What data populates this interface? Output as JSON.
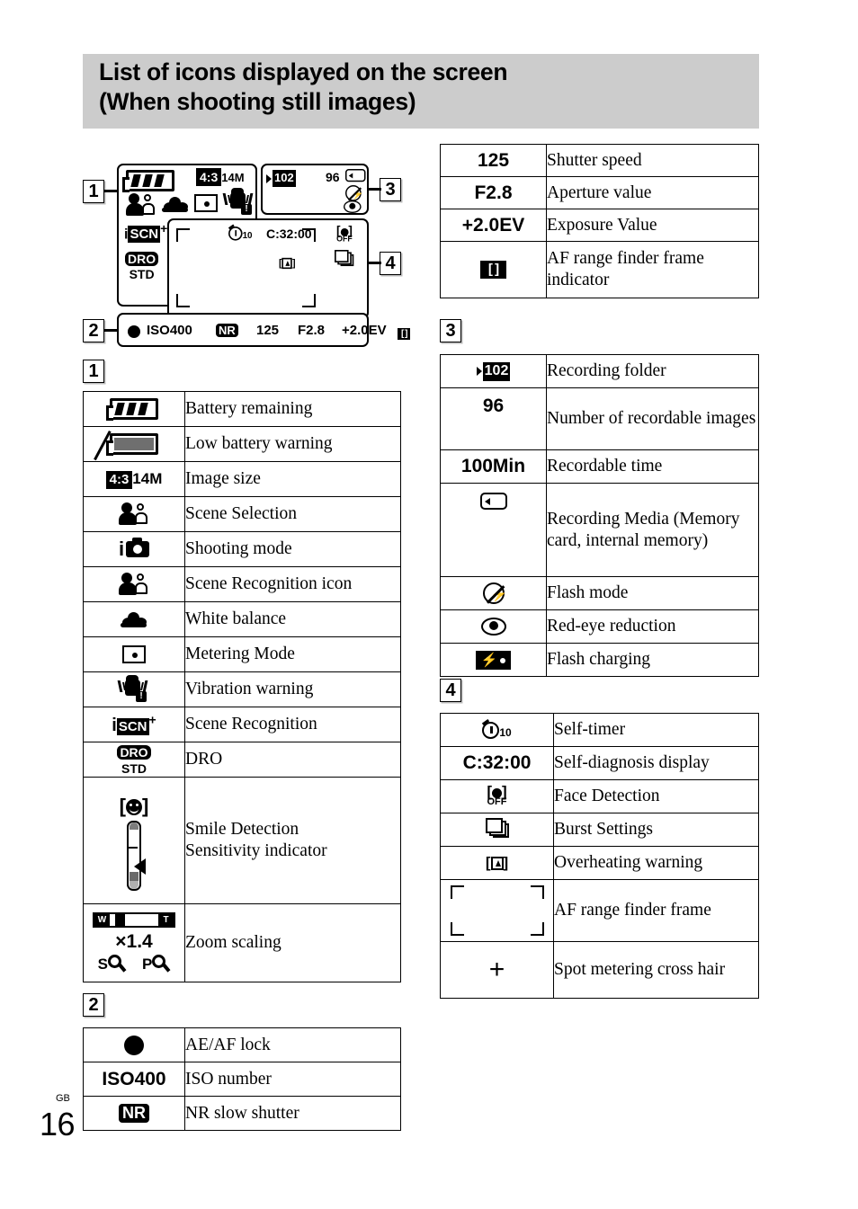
{
  "header": {
    "title": "List of icons displayed on the screen\n(When shooting still images)"
  },
  "page": {
    "lang": "GB",
    "number": "16"
  },
  "markers": {
    "one": "1",
    "two": "2",
    "three": "3",
    "four": "4"
  },
  "lcd": {
    "image_size": "14M",
    "aspect": "4:3",
    "scn_i": "i",
    "scn_box": "SCN",
    "scn_plus": "+",
    "dro_top": "DRO",
    "dro_bot": "STD",
    "folder": "102",
    "recordable_images": "96",
    "self_timer_num": "10",
    "self_diagnosis": "C:32:00",
    "face_off": "OFF",
    "status_iso": "ISO400",
    "status_nr": "NR",
    "status_shutter": "125",
    "status_aperture": "F2.8",
    "status_ev": "+2.0EV"
  },
  "table1": {
    "rows": [
      {
        "icon": "battery-remaining-icon",
        "desc": "Battery remaining"
      },
      {
        "icon": "low-battery-warning-icon",
        "desc": "Low battery warning"
      },
      {
        "icon": "image-size-icon",
        "desc": "Image size",
        "value": "14M",
        "aspect": "4:3"
      },
      {
        "icon": "scene-selection-icon",
        "desc": "Scene Selection"
      },
      {
        "icon": "shooting-mode-icon",
        "desc": "Shooting mode",
        "value": "i"
      },
      {
        "icon": "scene-recognition-icon",
        "desc": "Scene Recognition icon"
      },
      {
        "icon": "white-balance-icon",
        "desc": "White balance"
      },
      {
        "icon": "metering-mode-icon",
        "desc": "Metering Mode"
      },
      {
        "icon": "vibration-warning-icon",
        "desc": "Vibration warning"
      },
      {
        "icon": "scene-recognition-iscn-icon",
        "desc": "Scene Recognition",
        "value": "i",
        "box": "SCN",
        "sup": "+"
      },
      {
        "icon": "dro-icon",
        "desc": "DRO",
        "top": "DRO",
        "bot": "STD"
      },
      {
        "icon": "smile-detection-icon",
        "desc": "Smile Detection\nSensitivity indicator"
      },
      {
        "icon": "zoom-scaling-icon",
        "desc": "Zoom scaling",
        "w": "W",
        "t": "T",
        "mag": "×1.4",
        "s": "S",
        "p": "P"
      }
    ]
  },
  "table2": {
    "rows": [
      {
        "icon": "ae-af-lock-icon",
        "desc": "AE/AF lock"
      },
      {
        "icon": "iso-number-value",
        "value": "ISO400",
        "desc": "ISO number"
      },
      {
        "icon": "nr-slow-shutter-icon",
        "value": "NR",
        "desc": "NR slow shutter"
      }
    ]
  },
  "table_top_right": {
    "rows": [
      {
        "value": "125",
        "desc": "Shutter speed"
      },
      {
        "value": "F2.8",
        "desc": "Aperture value"
      },
      {
        "value": "+2.0EV",
        "desc": "Exposure Value"
      },
      {
        "icon": "af-range-finder-frame-indicator-icon",
        "desc": "AF range finder frame indicator"
      }
    ]
  },
  "table3": {
    "rows": [
      {
        "icon": "recording-folder-icon",
        "value": "102",
        "desc": "Recording folder"
      },
      {
        "value": "96",
        "desc": "Number of recordable images"
      },
      {
        "value": "100Min",
        "desc": "Recordable time"
      },
      {
        "icon": "recording-media-icon",
        "desc": "Recording Media (Memory card, internal memory)"
      },
      {
        "icon": "flash-mode-icon",
        "desc": "Flash mode"
      },
      {
        "icon": "red-eye-reduction-icon",
        "desc": "Red-eye reduction"
      },
      {
        "icon": "flash-charging-icon",
        "desc": "Flash charging"
      }
    ]
  },
  "table4": {
    "rows": [
      {
        "icon": "self-timer-icon",
        "value": "10",
        "desc": "Self-timer"
      },
      {
        "value": "C:32:00",
        "desc": "Self-diagnosis display"
      },
      {
        "icon": "face-detection-icon",
        "value": "OFF",
        "desc": "Face Detection"
      },
      {
        "icon": "burst-settings-icon",
        "desc": "Burst Settings"
      },
      {
        "icon": "overheating-warning-icon",
        "desc": "Overheating warning"
      },
      {
        "icon": "af-range-finder-frame-icon",
        "desc": "AF range finder frame"
      },
      {
        "icon": "spot-metering-cross-hair-icon",
        "desc": "Spot metering cross hair"
      }
    ]
  }
}
